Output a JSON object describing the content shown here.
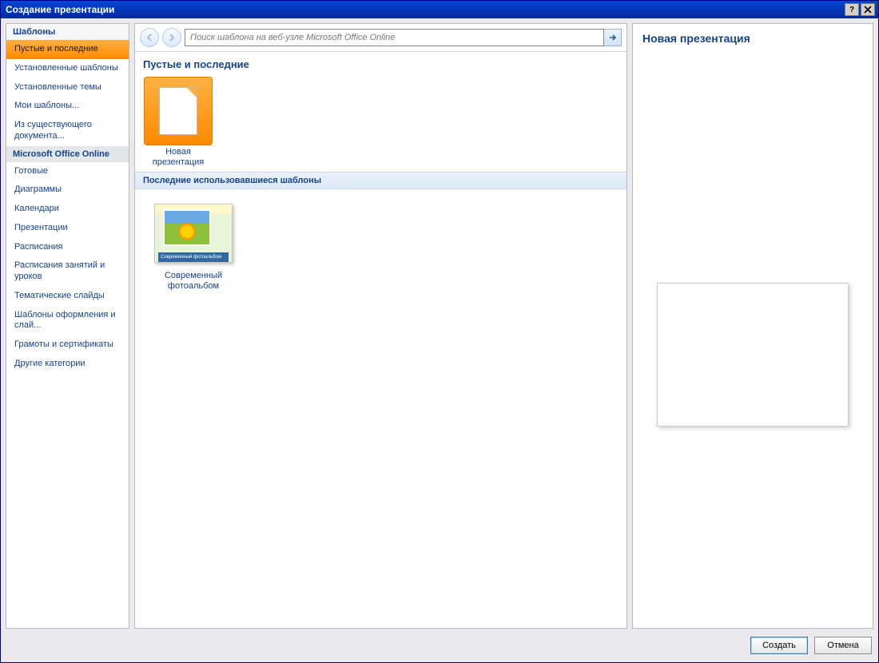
{
  "window": {
    "title": "Создание презентации"
  },
  "sidebar": {
    "header1": "Шаблоны",
    "items1": [
      {
        "label": "Пустые и последние"
      },
      {
        "label": "Установленные шаблоны"
      },
      {
        "label": "Установленные темы"
      },
      {
        "label": "Мои шаблоны..."
      },
      {
        "label": "Из существующего документа..."
      }
    ],
    "header2": "Microsoft Office Online",
    "items2": [
      {
        "label": "Готовые"
      },
      {
        "label": "Диаграммы"
      },
      {
        "label": "Календари"
      },
      {
        "label": "Презентации"
      },
      {
        "label": "Расписания"
      },
      {
        "label": "Расписания занятий и уроков"
      },
      {
        "label": "Тематические слайды"
      },
      {
        "label": "Шаблоны оформления и слай..."
      },
      {
        "label": "Грамоты и сертификаты"
      },
      {
        "label": "Другие категории"
      }
    ]
  },
  "search": {
    "placeholder": "Поиск шаблона на веб-узле Microsoft Office Online"
  },
  "main": {
    "section_title": "Пустые и последние",
    "new_presentation": "Новая презентация",
    "recent_header": "Последние использовавшиеся шаблоны",
    "recent_items": [
      {
        "label": "Современный фотоальбом",
        "strip": "Современный фотоальбом"
      }
    ]
  },
  "preview": {
    "title": "Новая презентация"
  },
  "footer": {
    "create": "Создать",
    "cancel": "Отмена"
  }
}
